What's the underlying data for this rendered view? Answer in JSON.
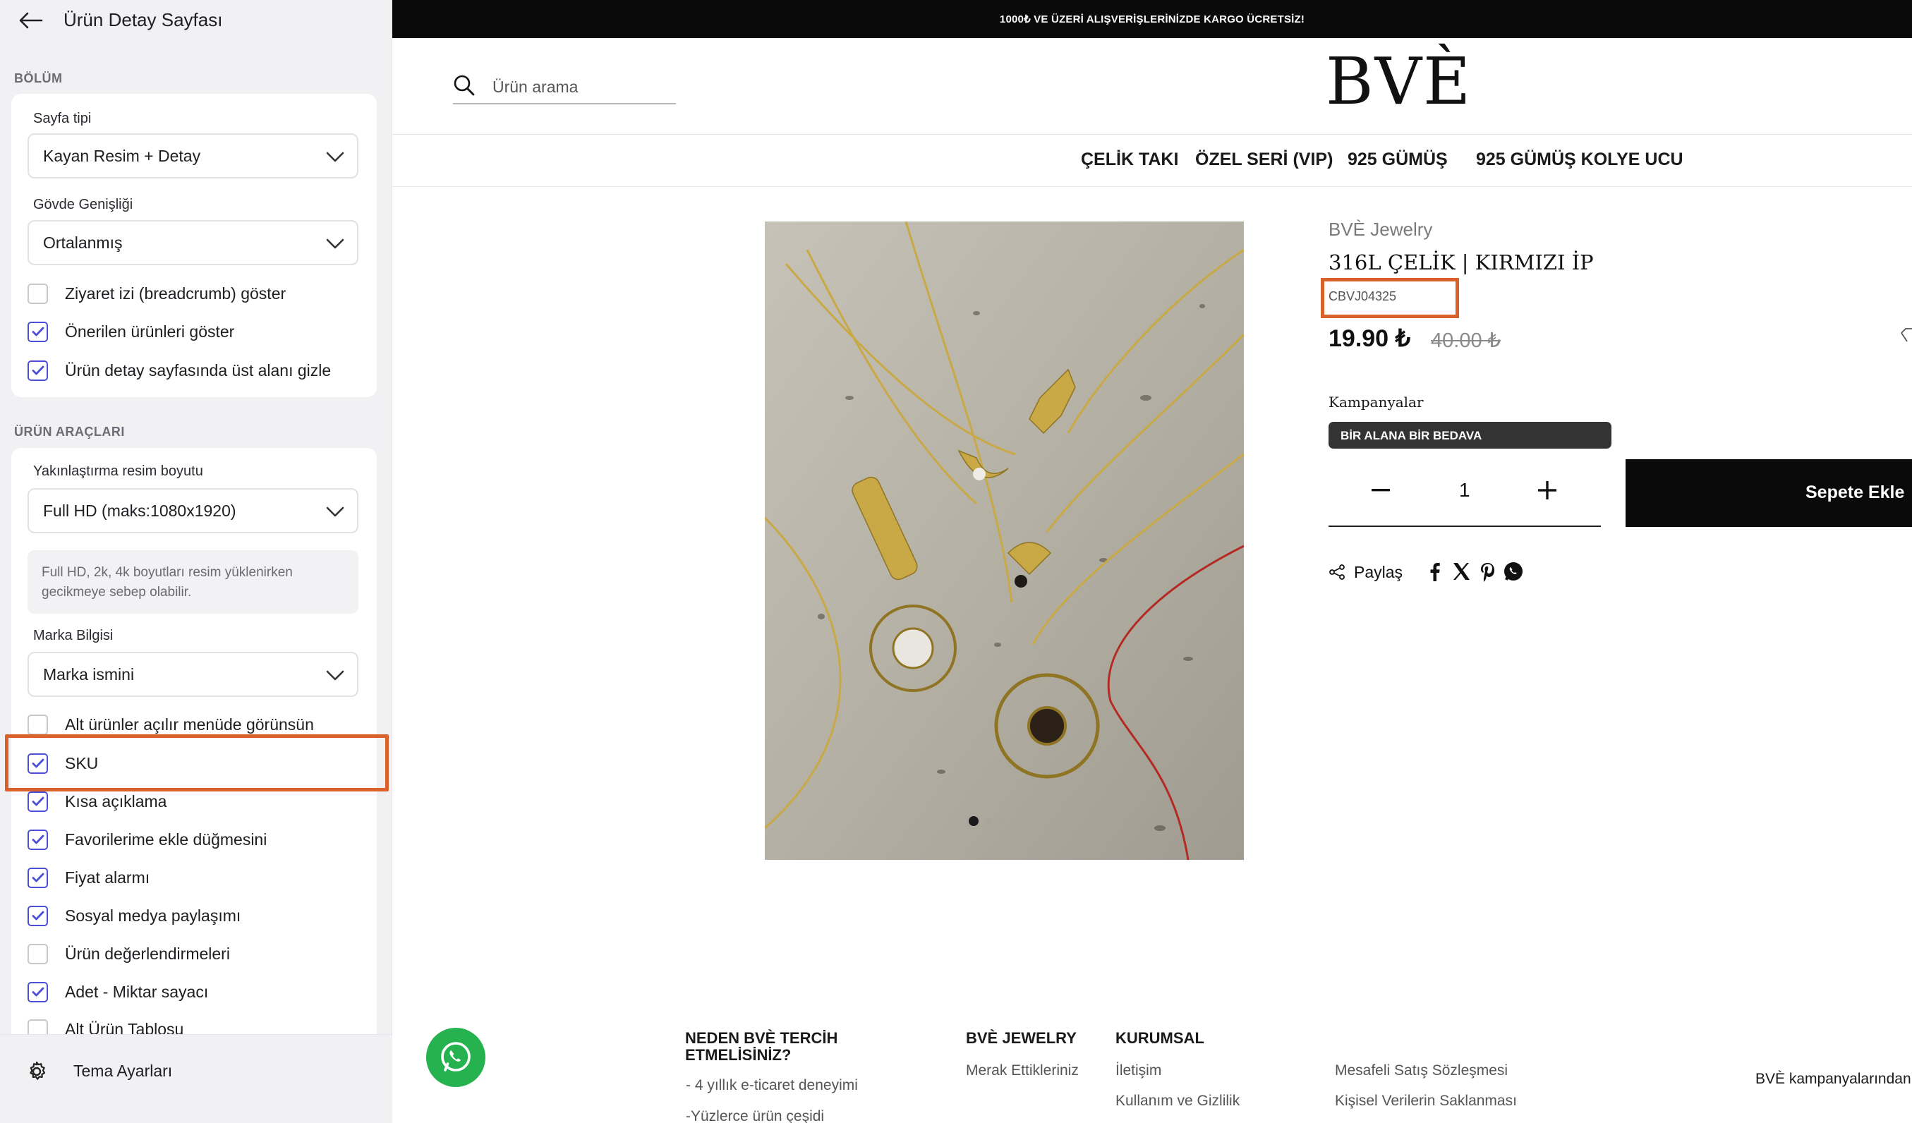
{
  "sidebar": {
    "title": "Ürün Detay Sayfası",
    "sections": {
      "bolum": "BÖLÜM",
      "urun_araclari": "ÜRÜN ARAÇLARI"
    },
    "page_type": {
      "label": "Sayfa tipi",
      "value": "Kayan Resim + Detay"
    },
    "body_width": {
      "label": "Gövde Genişliği",
      "value": "Ortalanmış"
    },
    "checks1": [
      {
        "label": "Ziyaret izi (breadcrumb) göster",
        "checked": false
      },
      {
        "label": "Önerilen ürünleri göster",
        "checked": true
      },
      {
        "label": "Ürün detay sayfasında üst alanı gizle",
        "checked": true
      }
    ],
    "zoom_size": {
      "label": "Yakınlaştırma resim boyutu",
      "value": "Full HD (maks:1080x1920)"
    },
    "zoom_info": "Full HD, 2k, 4k boyutları resim yüklenirken gecikmeye sebep olabilir.",
    "brand_info": {
      "label": "Marka Bilgisi",
      "value": "Marka ismini"
    },
    "checks2": [
      {
        "label": "Alt ürünler açılır menüde görünsün",
        "checked": false
      },
      {
        "label": "SKU",
        "checked": true
      },
      {
        "label": "Kısa açıklama",
        "checked": true
      },
      {
        "label": "Favorilerime ekle düğmesini",
        "checked": true
      },
      {
        "label": "Fiyat alarmı",
        "checked": true
      },
      {
        "label": "Sosyal medya paylaşımı",
        "checked": true
      },
      {
        "label": "Ürün değerlendirmeleri",
        "checked": false
      },
      {
        "label": "Adet - Miktar sayacı",
        "checked": true
      },
      {
        "label": "Alt Ürün Tablosu",
        "checked": false
      }
    ],
    "footer": "Tema Ayarları"
  },
  "store": {
    "announcement": "1000₺ VE ÜZERİ ALIŞVERİŞLERİNİZDE KARGO ÜCRETSİZ!",
    "search_placeholder": "Ürün arama",
    "logo": "BVÈ",
    "nav": [
      "ÇELİK TAKI",
      "ÖZEL SERİ (VIP)",
      "925 GÜMÜŞ",
      "925 GÜMÜŞ KOLYE UCU"
    ],
    "product": {
      "brand": "BVÈ Jewelry",
      "name": "316L ÇELİK  |  KIRMIZI İP",
      "sku": "CBVJ04325",
      "price": "19.90 ₺",
      "old_price": "40.00 ₺",
      "campaigns_label": "Kampanyalar",
      "campaign_badge": "BİR ALANA BİR BEDAVA",
      "quantity": "1",
      "add_to_cart": "Sepete Ekle",
      "share_label": "Paylaş",
      "image_dots": 3,
      "active_dot": 0
    },
    "footer": {
      "col1_title": "NEDEN BVÈ TERCİH ETMELİSİNİZ?",
      "col1_items": [
        "- 4 yıllık e-ticaret deneyimi",
        "-Yüzlerce ürün çeşidi"
      ],
      "col2_title": "BVÈ JEWELRY",
      "col2_items": [
        "Merak Ettikleriniz"
      ],
      "col3_title": "KURUMSAL",
      "col3_items": [
        "İletişim",
        "Kullanım ve Gizlilik"
      ],
      "col4_items": [
        "Mesafeli Satış Sözleşmesi",
        "Kişisel Verilerin Saklanması"
      ],
      "col5_items": [
        "BVÈ kampanyalarından"
      ]
    }
  },
  "colors": {
    "highlight": "#d9622b",
    "checkbox_accent": "#4a4fd6",
    "whatsapp": "#25b24f",
    "topbar": "#0a0a0a"
  }
}
